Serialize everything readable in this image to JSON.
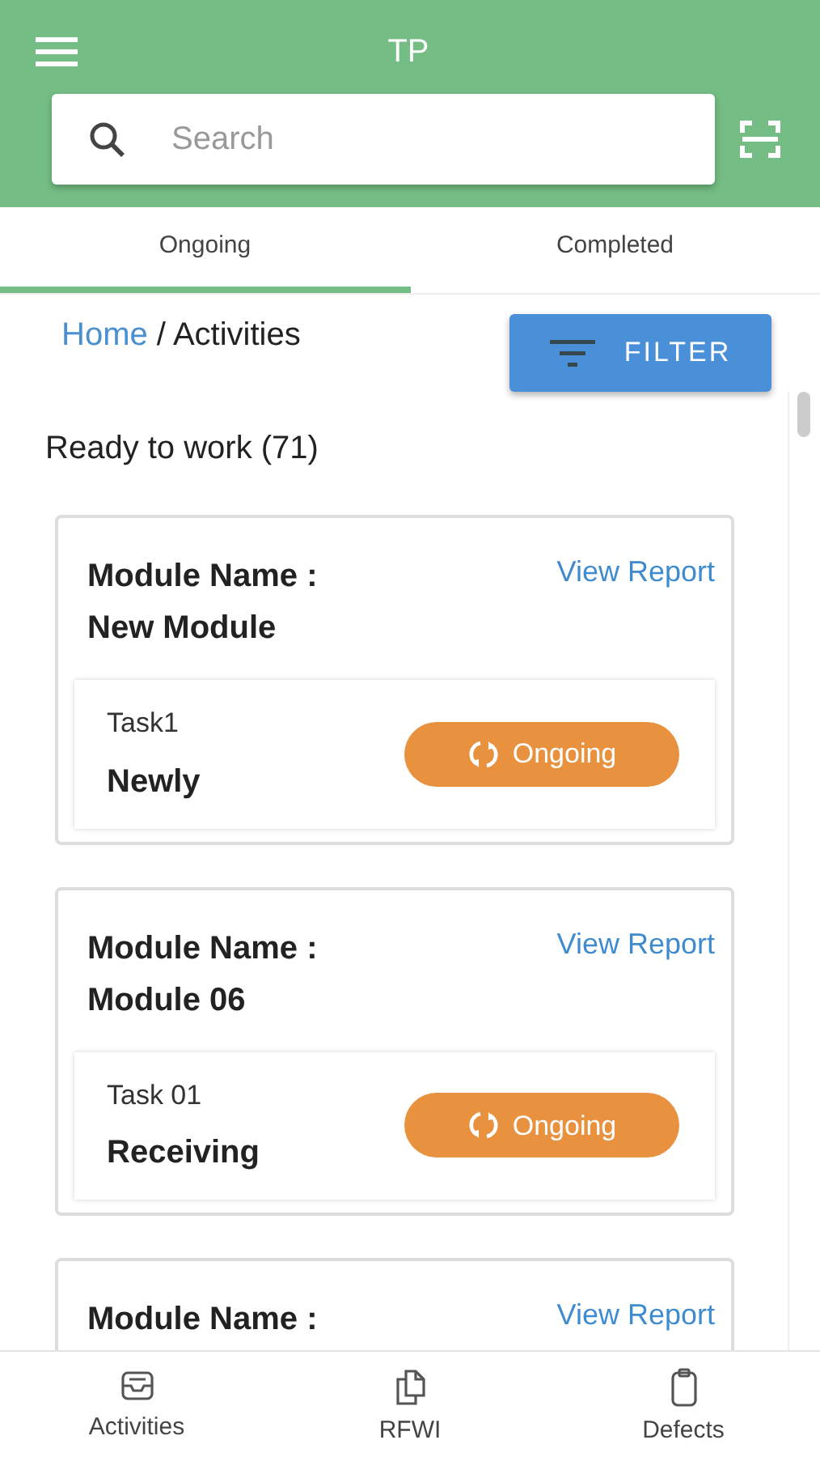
{
  "header": {
    "title": "TP",
    "search": {
      "placeholder": "Search"
    }
  },
  "tabs": [
    {
      "label": "Ongoing",
      "selected": true
    },
    {
      "label": "Completed",
      "selected": false
    }
  ],
  "breadcrumb": {
    "link": "Home",
    "separator": "/",
    "current": "Activities"
  },
  "filter_button": "FILTER",
  "section_title": "Ready to work (71)",
  "modules": [
    {
      "label": "Module Name :",
      "name": "New Module",
      "report_link": "View Report",
      "task": {
        "id": "Task1",
        "name": "Newly",
        "status": "Ongoing"
      }
    },
    {
      "label": "Module Name :",
      "name": "Module 06",
      "report_link": "View Report",
      "task": {
        "id": "Task 01",
        "name": "Receiving",
        "status": "Ongoing"
      }
    },
    {
      "label": "Module Name :",
      "report_link": "View Report"
    }
  ],
  "bottom_nav": [
    {
      "label": "Activities",
      "kind": "inbox"
    },
    {
      "label": "RFWI",
      "kind": "documents"
    },
    {
      "label": "Defects",
      "kind": "clipboard"
    }
  ]
}
